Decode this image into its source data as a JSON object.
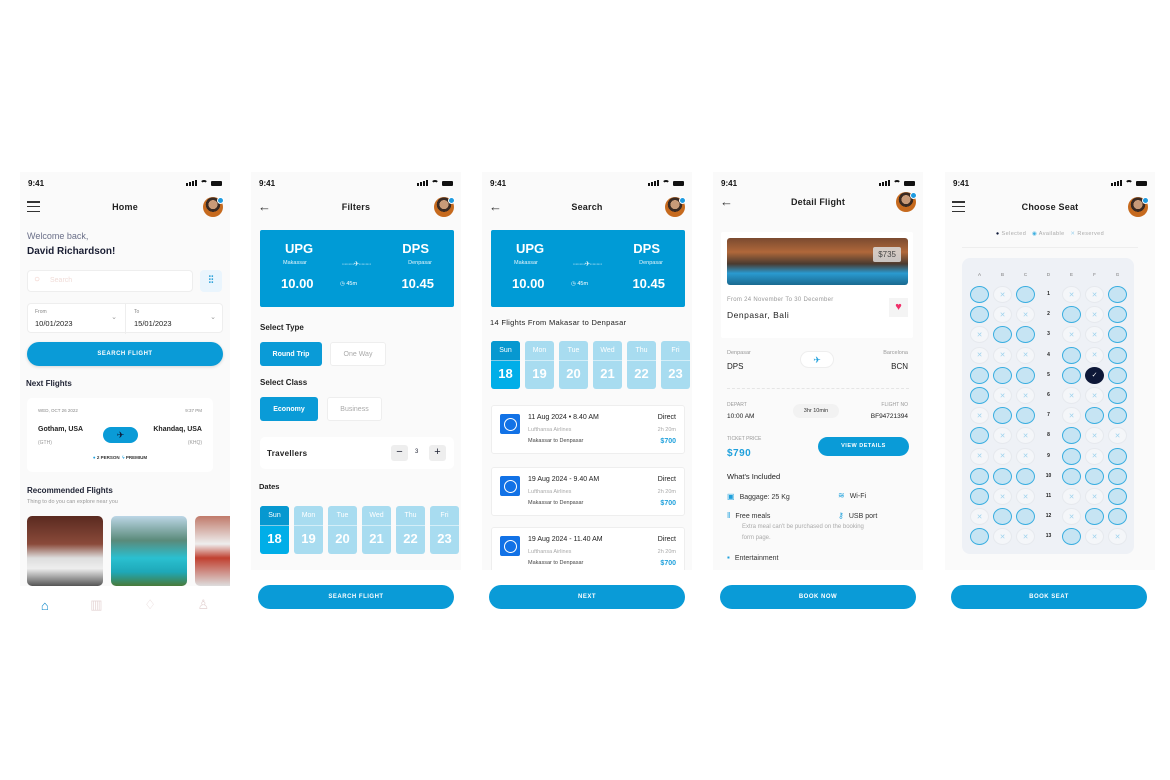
{
  "status_time": "9:41",
  "screens": {
    "home": {
      "title": "Home",
      "welcome": "Welcome back,",
      "user_name": "David Richardson!",
      "search_placeholder": "Search",
      "from_label": "From",
      "from_value": "10/01/2023",
      "to_label": "To",
      "to_value": "15/01/2023",
      "search_button": "SEARCH FLIGHT",
      "next_flights_title": "Next Flights",
      "next_flight": {
        "date": "WED, OCT 26 2022",
        "time": "9:37 PM",
        "from_city": "Gotham, USA",
        "from_code": "(GTH)",
        "to_city": "Khandaq, USA",
        "to_code": "(KHQ)",
        "persons": "2 PERSON",
        "class": "PREMIUM"
      },
      "recommended_title": "Recommended Flights",
      "recommended_subtitle": "Thing to do you can explore near you",
      "recommended_items": [
        "hotel-room",
        "mountain-lake",
        "wine-room"
      ],
      "nav_items": [
        "home-icon",
        "map-icon",
        "bell-icon",
        "profile-icon"
      ]
    },
    "filters": {
      "title": "Filters",
      "route": {
        "from_code": "UPG",
        "from_city": "Makassar",
        "from_time": "10.00",
        "to_code": "DPS",
        "to_city": "Denpasar",
        "to_time": "10.45",
        "duration": "45m"
      },
      "select_type_label": "Select Type",
      "types": [
        "Round Trip",
        "One Way"
      ],
      "selected_type": "Round Trip",
      "select_class_label": "Select Class",
      "classes": [
        "Economy",
        "Business"
      ],
      "selected_class": "Economy",
      "travellers_label": "Travellers",
      "travellers_count": "3",
      "dates_label": "Dates",
      "dates": [
        {
          "day": "Sun",
          "num": "18"
        },
        {
          "day": "Mon",
          "num": "19"
        },
        {
          "day": "Tue",
          "num": "20"
        },
        {
          "day": "Wed",
          "num": "21"
        },
        {
          "day": "Thu",
          "num": "22"
        },
        {
          "day": "Fri",
          "num": "23"
        }
      ],
      "selected_date": "18",
      "button": "SEARCH FLIGHT"
    },
    "search": {
      "title": "Search",
      "route": {
        "from_code": "UPG",
        "from_city": "Makassar",
        "from_time": "10.00",
        "to_code": "DPS",
        "to_city": "Denpasar",
        "to_time": "10.45",
        "duration": "45m"
      },
      "results_heading": "14 Flights From Makasar to Denpasar",
      "dates": [
        {
          "day": "Sun",
          "num": "18"
        },
        {
          "day": "Mon",
          "num": "19"
        },
        {
          "day": "Tue",
          "num": "20"
        },
        {
          "day": "Wed",
          "num": "21"
        },
        {
          "day": "Thu",
          "num": "22"
        },
        {
          "day": "Fri",
          "num": "23"
        }
      ],
      "flights": [
        {
          "datetime": "11 Aug 2024  •  8.40 AM",
          "airline": "Lufthansa Airlines",
          "route": "Makassar to Denpasar",
          "type": "Direct",
          "duration": "2h 20m",
          "price": "$700"
        },
        {
          "datetime": "19 Aug 2024 - 9.40 AM",
          "airline": "Lufthansa Airlines",
          "route": "Makassar to Denpasar",
          "type": "Direct",
          "duration": "2h 20m",
          "price": "$700"
        },
        {
          "datetime": "19 Aug 2024 - 11.40 AM",
          "airline": "Lufthansa Airlines",
          "route": "Makassar to Denpasar",
          "type": "Direct",
          "duration": "2h 20m",
          "price": "$700"
        }
      ],
      "button": "NEXT"
    },
    "detail": {
      "title": "Detail Flight",
      "image_price": "$735",
      "date_range": "From 24 November To 30 December",
      "destination": "Denpasar, Bali",
      "from_city": "Denpasar",
      "from_code": "DPS",
      "to_city": "Barcelona",
      "to_code": "BCN",
      "depart_label": "DEPART",
      "depart_value": "10:00 AM",
      "duration": "3hr 10min",
      "flight_no_label": "FLIGHT NO",
      "flight_no_value": "BF94721394",
      "ticket_price_label": "TICKET PRICE",
      "ticket_price": "$790",
      "view_details": "VIEW DETAILS",
      "included_title": "What's Included",
      "included": {
        "baggage": "Baggage: 25 Kg",
        "wifi": "Wi-Fi",
        "meals": "Free meals",
        "usb": "USB port",
        "meals_note": "Extra meal can't be purchased on the booking form page.",
        "entertainment": "Entertainment"
      },
      "button": "BOOK NOW",
      "accent": "#0a9bd7",
      "heart_color": "#f0306a"
    },
    "seat": {
      "title": "Choose Seat",
      "legend": {
        "selected": "Selected",
        "available": "Available",
        "reserved": "Reserved"
      },
      "columns": [
        "A",
        "B",
        "C",
        "D",
        "E",
        "F",
        "G"
      ],
      "rows": [
        {
          "num": "1",
          "left": "AXA",
          "right": "XXA"
        },
        {
          "num": "2",
          "left": "AXX",
          "right": "AXA"
        },
        {
          "num": "3",
          "left": "XAA",
          "right": "XXA"
        },
        {
          "num": "4",
          "left": "XXX",
          "right": "AXA"
        },
        {
          "num": "5",
          "left": "AAA",
          "right": "ASA"
        },
        {
          "num": "6",
          "left": "AXX",
          "right": "XXA"
        },
        {
          "num": "7",
          "left": "XAA",
          "right": "XAA"
        },
        {
          "num": "8",
          "left": "AXX",
          "right": "AXX"
        },
        {
          "num": "9",
          "left": "XXX",
          "right": "AXA"
        },
        {
          "num": "10",
          "left": "AAA",
          "right": "AAA"
        },
        {
          "num": "11",
          "left": "AXX",
          "right": "XXA"
        },
        {
          "num": "12",
          "left": "XAA",
          "right": "XAA"
        },
        {
          "num": "13",
          "left": "AXX",
          "right": "AXX"
        }
      ],
      "selected_seat": "5F",
      "button": "BOOK SEAT"
    }
  }
}
